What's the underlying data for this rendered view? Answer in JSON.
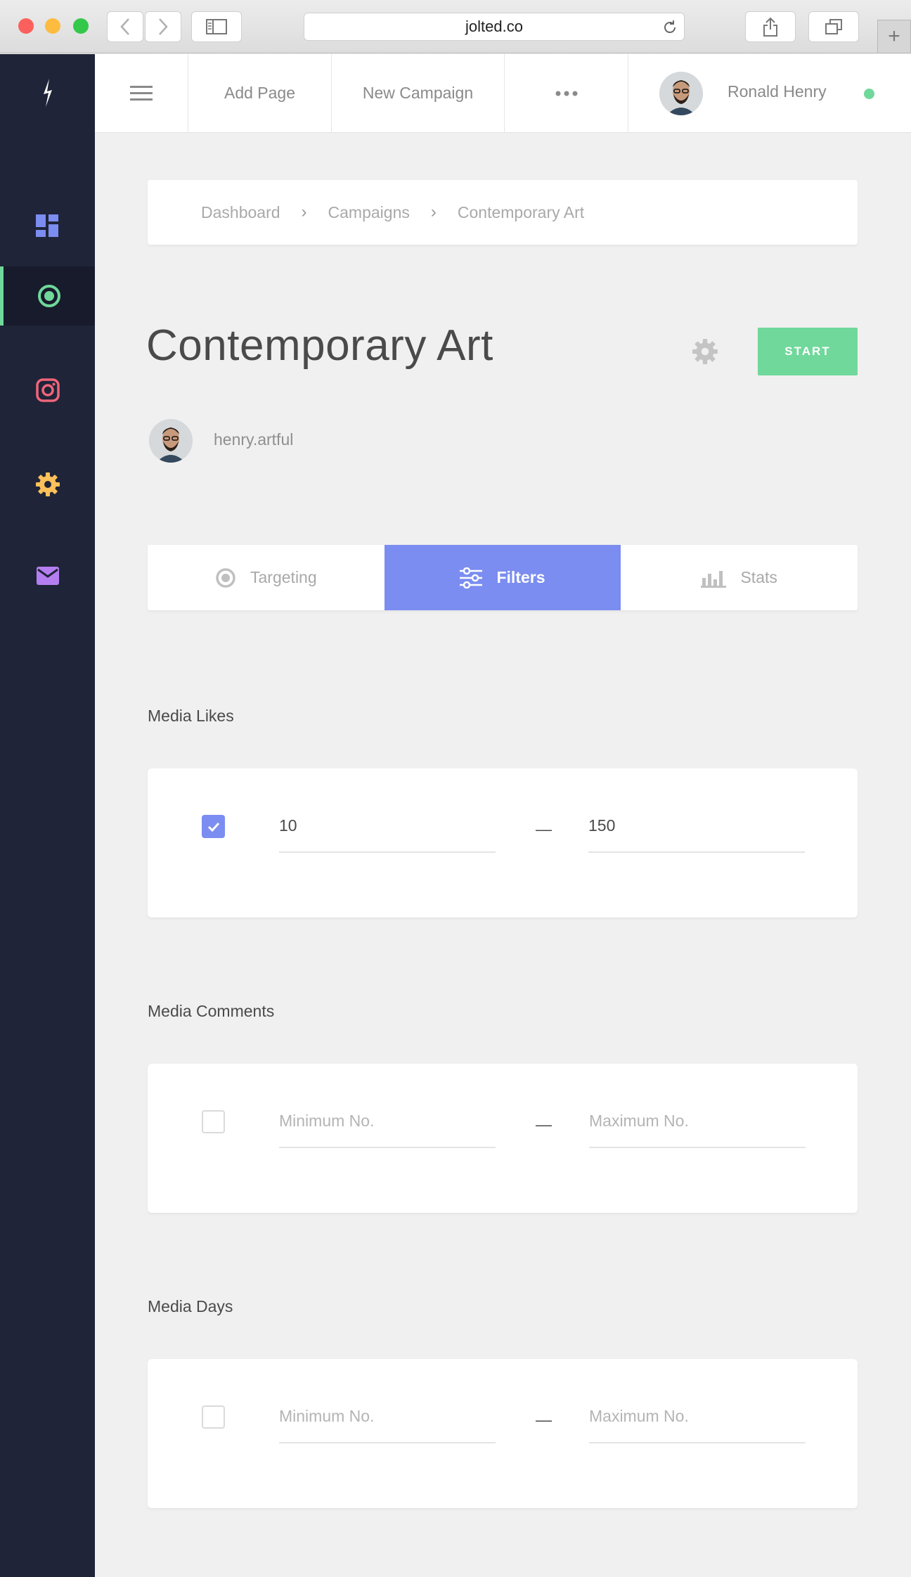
{
  "browser": {
    "url": "jolted.co",
    "traffic_lights": [
      "#fc605c",
      "#fdbc40",
      "#34c84a"
    ]
  },
  "sidebar": {
    "items": [
      {
        "icon": "dashboard-icon",
        "color": "#7b8df0",
        "active": false
      },
      {
        "icon": "target-icon",
        "color": "#6fd89a",
        "active": true
      },
      {
        "icon": "instagram-icon",
        "color": "#f0657a",
        "active": false
      },
      {
        "icon": "gear-icon",
        "color": "#fdc05a",
        "active": false
      },
      {
        "icon": "mail-icon",
        "color": "#b57ef0",
        "active": false
      }
    ]
  },
  "topnav": {
    "add_page": "Add Page",
    "new_campaign": "New Campaign",
    "user_name": "Ronald Henry",
    "status_color": "#6fd89a"
  },
  "breadcrumb": {
    "items": [
      "Dashboard",
      "Campaigns",
      "Contemporary Art"
    ],
    "separator": "›"
  },
  "page": {
    "title": "Contemporary Art",
    "start_label": "START",
    "account": "henry.artful"
  },
  "tabs": [
    {
      "label": "Targeting",
      "icon": "target-icon",
      "active": false
    },
    {
      "label": "Filters",
      "icon": "sliders-icon",
      "active": true
    },
    {
      "label": "Stats",
      "icon": "bar-chart-icon",
      "active": false
    }
  ],
  "filters": [
    {
      "label": "Media Likes",
      "checked": true,
      "min_value": "10",
      "max_value": "150",
      "min_placeholder": "",
      "max_placeholder": ""
    },
    {
      "label": "Media Comments",
      "checked": false,
      "min_value": "",
      "max_value": "",
      "min_placeholder": "Minimum No.",
      "max_placeholder": "Maximum No."
    },
    {
      "label": "Media Days",
      "checked": false,
      "min_value": "",
      "max_value": "",
      "min_placeholder": "Minimum No.",
      "max_placeholder": "Maximum No."
    }
  ],
  "range_separator": "—",
  "colors": {
    "accent": "#7b8df0",
    "success": "#6fd89a",
    "sidebar_bg": "#1f2438"
  }
}
